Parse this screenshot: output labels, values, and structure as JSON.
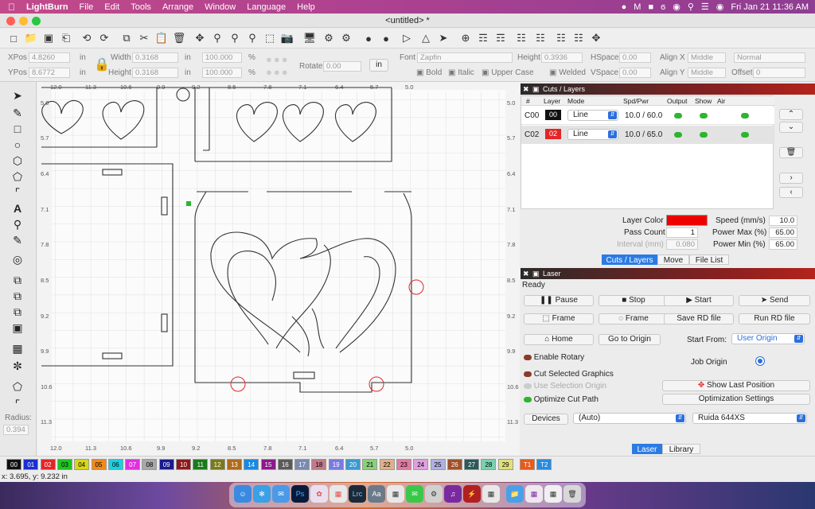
{
  "menubar": {
    "apple": "",
    "app": "LightBurn",
    "items": [
      "File",
      "Edit",
      "Tools",
      "Arrange",
      "Window",
      "Language",
      "Help"
    ],
    "clock": "Fri Jan 21  11:36 AM"
  },
  "window": {
    "title": "<untitled> *"
  },
  "props": {
    "xpos_label": "XPos",
    "xpos": "4.8260",
    "ypos_label": "YPos",
    "ypos": "8.6772",
    "unit": "in",
    "width_label": "Width",
    "width": "0.3168",
    "height_label": "Height",
    "height": "0.3168",
    "scale_w": "100.000",
    "scale_h": "100.000",
    "pct": "%",
    "rotate_label": "Rotate",
    "rotate": "0.00",
    "in_button": "in",
    "font_label": "Font",
    "font": "Zapfin",
    "font_height_label": "Height",
    "font_height": "0.3936",
    "hspace_label": "HSpace",
    "hspace": "0.00",
    "vspace_label": "VSpace",
    "vspace": "0.00",
    "align_x_label": "Align X",
    "align_x": "Middle",
    "align_y_label": "Align Y",
    "align_y": "Middle",
    "style": "Normal",
    "offset_label": "Offset",
    "offset": "0",
    "bold": "Bold",
    "italic": "Italic",
    "upper": "Upper Case",
    "welded": "Welded"
  },
  "ruler": {
    "top": [
      "12.0",
      "11.3",
      "10.6",
      "9.9",
      "9.2",
      "8.5",
      "7.8",
      "7.1",
      "6.4",
      "5.7",
      "5.0"
    ],
    "left": [
      "5.0",
      "5.7",
      "6.4",
      "7.1",
      "7.8",
      "8.5",
      "9.2",
      "9.9",
      "10.6",
      "11.3"
    ]
  },
  "cuts": {
    "title": "Cuts / Layers",
    "headers": [
      "#",
      "Layer",
      "Mode",
      "Spd/Pwr",
      "Output",
      "Show",
      "Air"
    ],
    "rows": [
      {
        "id": "C00",
        "layer": "00",
        "color": "#111111",
        "mode": "Line",
        "spdpwr": "10.0 / 60.0"
      },
      {
        "id": "C02",
        "layer": "02",
        "color": "#e52525",
        "mode": "Line",
        "spdpwr": "10.0 / 65.0"
      }
    ],
    "layer_color_label": "Layer Color",
    "layer_color": "#ee0000",
    "pass_count_label": "Pass Count",
    "pass_count": "1",
    "interval_label": "Interval (mm)",
    "interval": "0.080",
    "speed_label": "Speed (mm/s)",
    "speed": "10.0",
    "pmax_label": "Power Max (%)",
    "pmax": "65.00",
    "pmin_label": "Power Min (%)",
    "pmin": "65.00",
    "tabs": [
      "Cuts / Layers",
      "Move",
      "File List"
    ]
  },
  "laser": {
    "title": "Laser",
    "status": "Ready",
    "pause": "Pause",
    "stop": "Stop",
    "start": "Start",
    "send": "Send",
    "frame1": "Frame",
    "frame2": "Frame",
    "save_rd": "Save RD file",
    "run_rd": "Run RD file",
    "home": "Home",
    "goto_origin": "Go to Origin",
    "start_from_label": "Start From:",
    "start_from": "User Origin",
    "enable_rotary": "Enable Rotary",
    "job_origin": "Job Origin",
    "cut_selected": "Cut Selected Graphics",
    "use_selection": "Use Selection Origin",
    "show_last": "Show Last Position",
    "optimize": "Optimize Cut Path",
    "opt_settings": "Optimization Settings",
    "devices": "Devices",
    "device_sel": "(Auto)",
    "controller": "Ruida 644XS",
    "tabs": [
      "Laser",
      "Library"
    ]
  },
  "tools": {
    "radius_label": "Radius:",
    "radius": "0.394"
  },
  "palette": [
    {
      "n": "00",
      "c": "#111111",
      "t": "#fff"
    },
    {
      "n": "01",
      "c": "#1a2fd0",
      "t": "#fff"
    },
    {
      "n": "02",
      "c": "#e52525",
      "t": "#fff"
    },
    {
      "n": "03",
      "c": "#1fc41f",
      "t": "#000"
    },
    {
      "n": "04",
      "c": "#d6d61a",
      "t": "#000"
    },
    {
      "n": "05",
      "c": "#f08a1a",
      "t": "#000"
    },
    {
      "n": "06",
      "c": "#1ad0e0",
      "t": "#000"
    },
    {
      "n": "07",
      "c": "#e030e0",
      "t": "#fff"
    },
    {
      "n": "08",
      "c": "#a8a8a8",
      "t": "#000"
    },
    {
      "n": "09",
      "c": "#1a1a90",
      "t": "#fff"
    },
    {
      "n": "10",
      "c": "#8c1a1a",
      "t": "#fff"
    },
    {
      "n": "11",
      "c": "#1a7a1a",
      "t": "#fff"
    },
    {
      "n": "12",
      "c": "#7a7a1a",
      "t": "#fff"
    },
    {
      "n": "13",
      "c": "#b06a1a",
      "t": "#fff"
    },
    {
      "n": "14",
      "c": "#1a8ae0",
      "t": "#fff"
    },
    {
      "n": "15",
      "c": "#8a1a8a",
      "t": "#fff"
    },
    {
      "n": "16",
      "c": "#5a5a5a",
      "t": "#fff"
    },
    {
      "n": "17",
      "c": "#7a8ab0",
      "t": "#fff"
    },
    {
      "n": "18",
      "c": "#c07a8a",
      "t": "#000"
    },
    {
      "n": "19",
      "c": "#7a7ae0",
      "t": "#fff"
    },
    {
      "n": "20",
      "c": "#3a9ad0",
      "t": "#fff"
    },
    {
      "n": "21",
      "c": "#8ad07a",
      "t": "#000"
    },
    {
      "n": "22",
      "c": "#e0b08a",
      "t": "#000"
    },
    {
      "n": "23",
      "c": "#e07aa0",
      "t": "#000"
    },
    {
      "n": "24",
      "c": "#e0a0e0",
      "t": "#000"
    },
    {
      "n": "25",
      "c": "#b0b0e0",
      "t": "#000"
    },
    {
      "n": "26",
      "c": "#a0502a",
      "t": "#fff"
    },
    {
      "n": "27",
      "c": "#2a5a5a",
      "t": "#fff"
    },
    {
      "n": "28",
      "c": "#7ad0b0",
      "t": "#000"
    },
    {
      "n": "29",
      "c": "#e0e07a",
      "t": "#000"
    },
    {
      "n": "T1",
      "c": "#e85a1a",
      "t": "#fff"
    },
    {
      "n": "T2",
      "c": "#2a8ae0",
      "t": "#fff"
    }
  ],
  "status": {
    "coords": "x: 3.695, y: 9.232 in"
  }
}
